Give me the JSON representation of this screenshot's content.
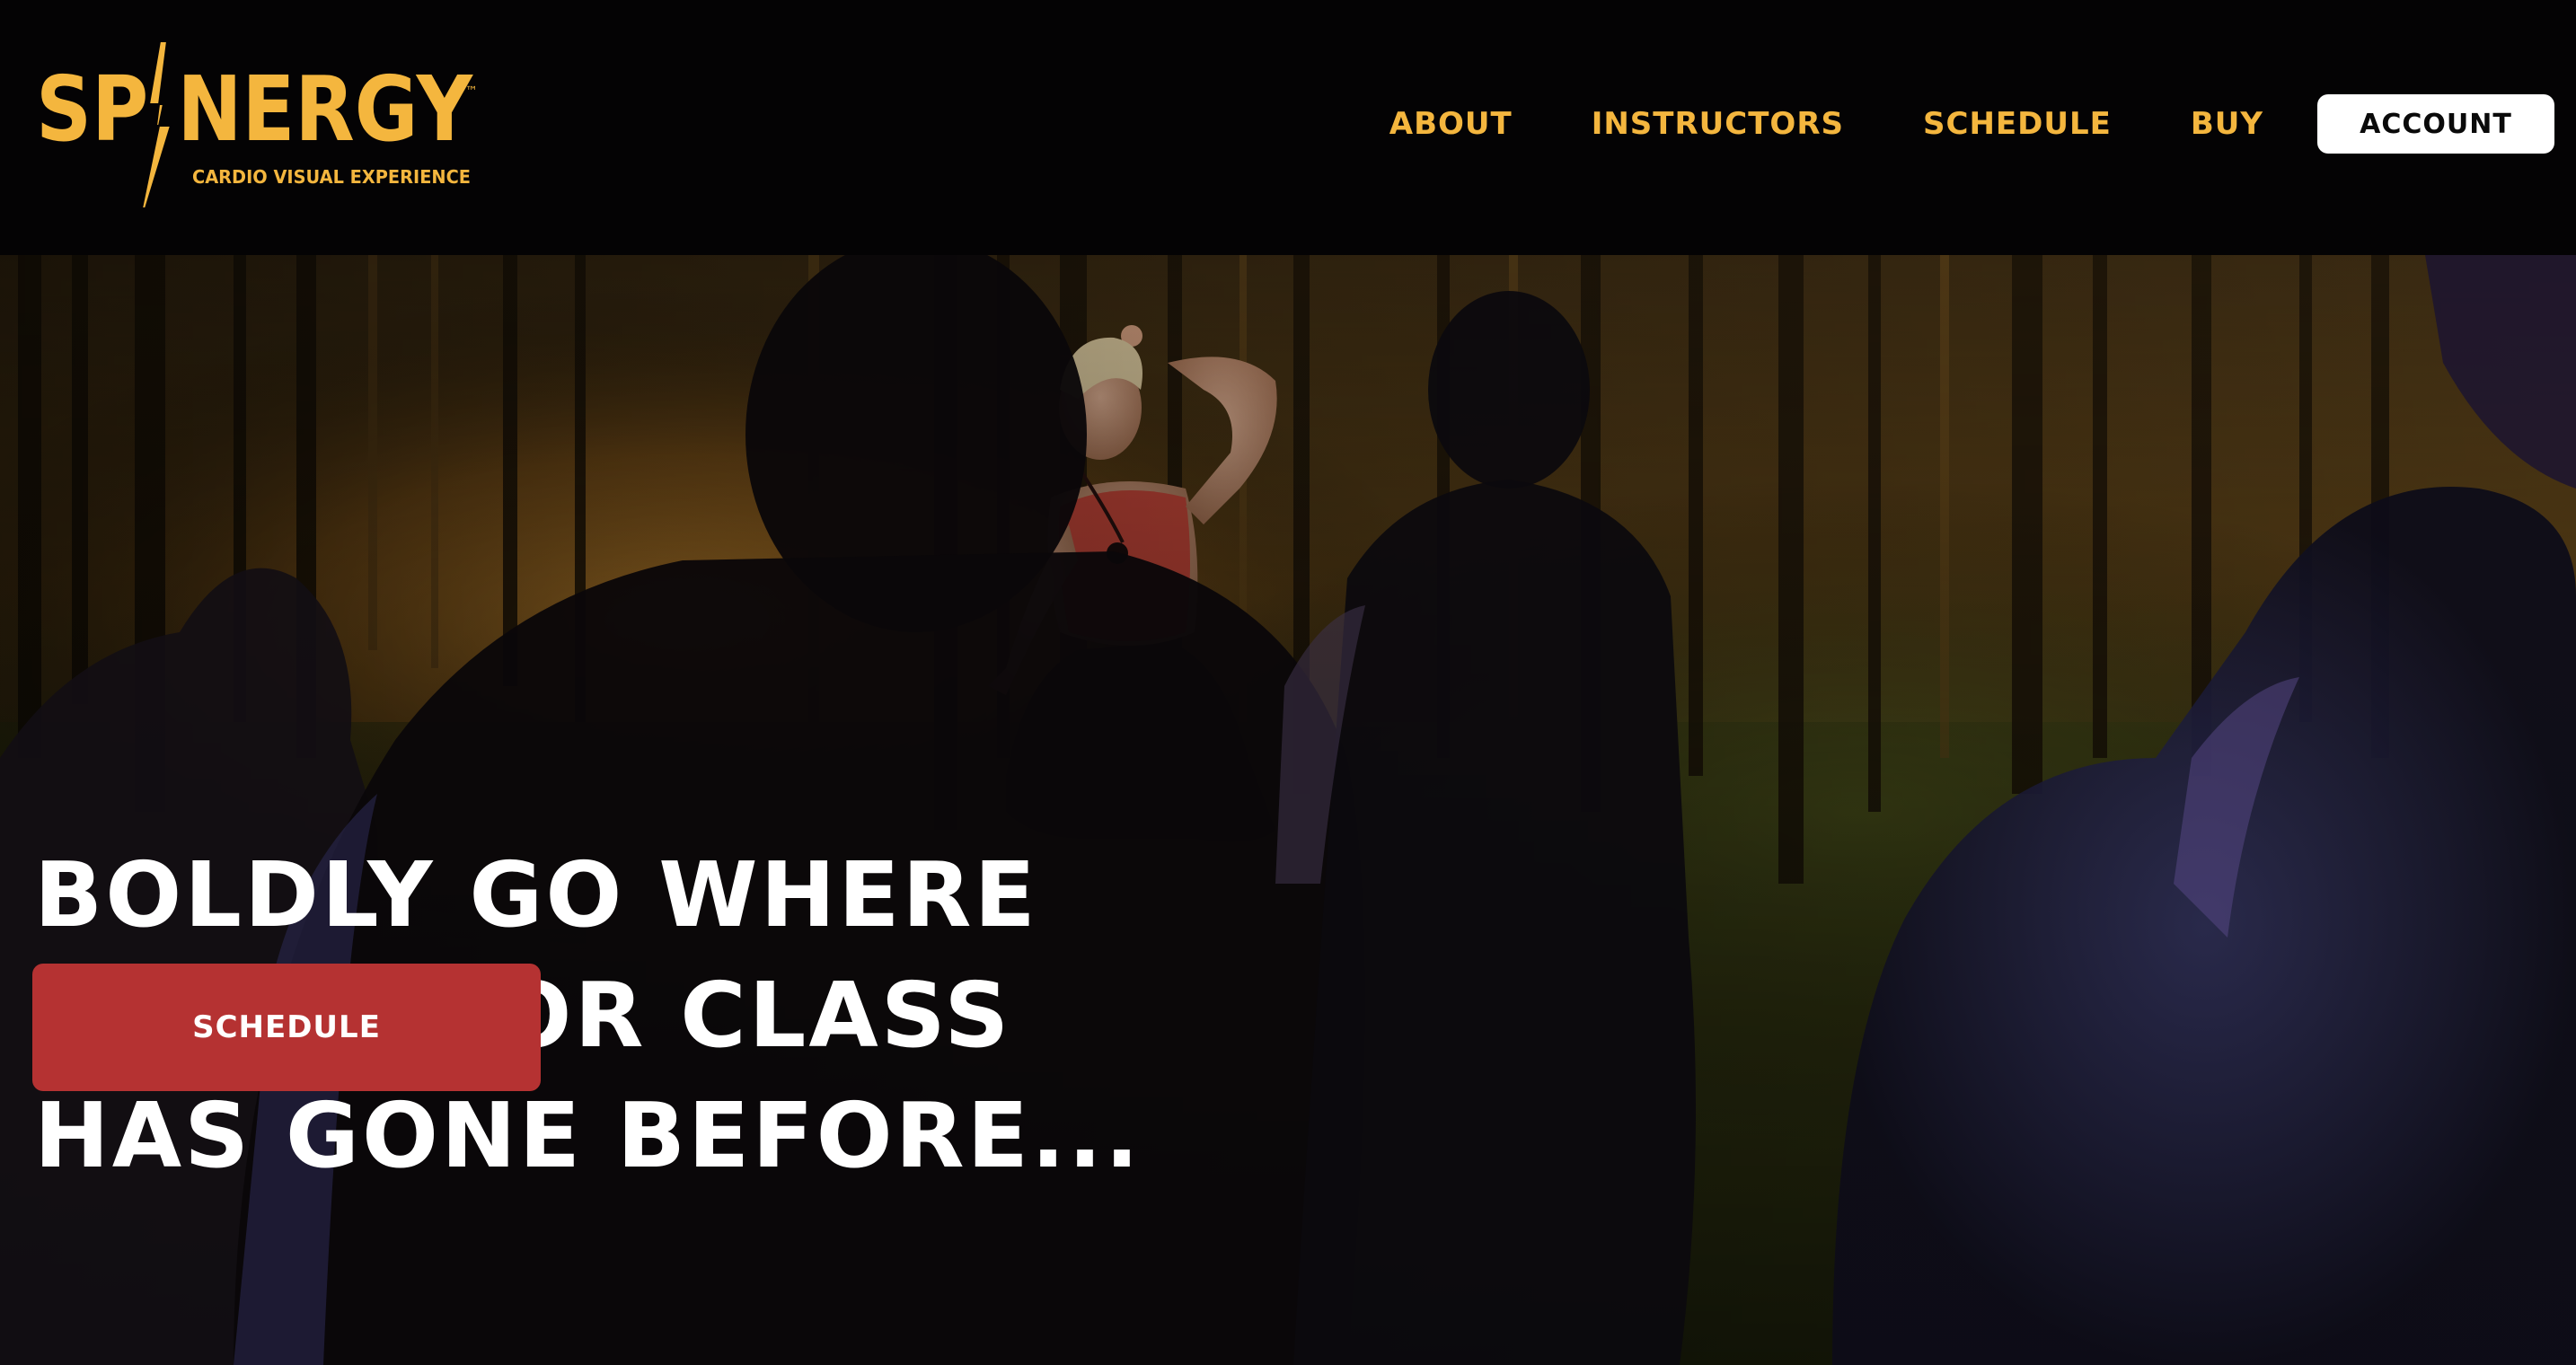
{
  "brand": {
    "name": "SPINERGY",
    "tagline": "CARDIO VISUAL EXPERIENCE",
    "trademark": "™",
    "color": "#f4b63e"
  },
  "nav": {
    "items": [
      {
        "label": "ABOUT"
      },
      {
        "label": "INSTRUCTORS"
      },
      {
        "label": "SCHEDULE"
      },
      {
        "label": "BUY"
      }
    ],
    "account_label": "ACCOUNT"
  },
  "hero": {
    "title_lines": [
      "BOLDLY GO WHERE",
      "NO INDOOR CLASS",
      "HAS GONE BEFORE..."
    ],
    "cta_label": "SCHEDULE",
    "cta_color": "#b53232"
  },
  "colors": {
    "header_bg": "#040304",
    "accent": "#f4b63e",
    "cta": "#b53232"
  }
}
